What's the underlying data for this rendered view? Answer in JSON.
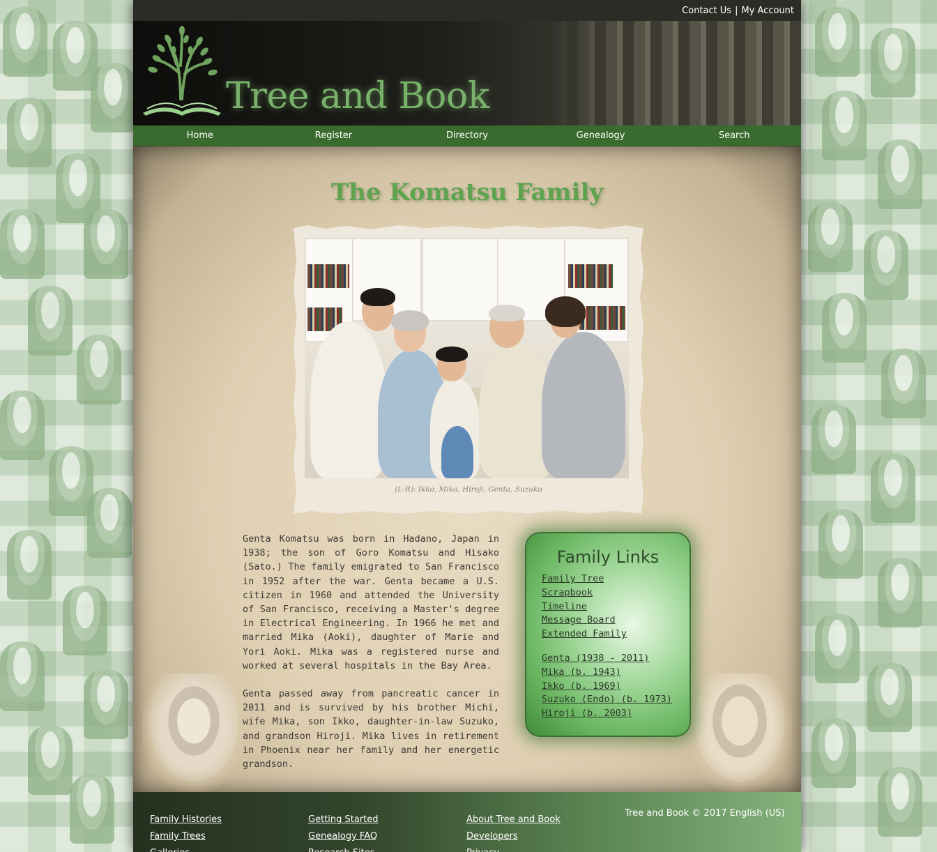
{
  "topbar": {
    "contact": "Contact Us",
    "separator": "|",
    "account": "My Account"
  },
  "site": {
    "title": "Tree and Book"
  },
  "nav": [
    {
      "label": "Home"
    },
    {
      "label": "Register"
    },
    {
      "label": "Directory"
    },
    {
      "label": "Genealogy"
    },
    {
      "label": "Search"
    }
  ],
  "main": {
    "title": "The Komatsu Family",
    "photo_caption": "(L-R): Ikko, Mika, Hiroji, Genta, Suzuko",
    "bio": [
      "Genta Komatsu was born in Hadano, Japan in 1938; the son of Goro Komatsu and Hisako (Sato.) The family emigrated to San Francisco in 1952 after the war. Genta became a U.S. citizen in 1960 and attended the University of San Francisco, receiving a Master's degree in Electrical Engineering. In 1966 he met and married Mika (Aoki), daughter of Marie and Yori Aoki. Mika was a registered nurse and worked at several hospitals in the Bay Area.",
      "Genta passed away from pancreatic cancer in 2011 and is survived by his brother Michi, wife Mika, son Ikko, daughter-in-law Suzuko, and grandson Hiroji. Mika lives in retirement in Phoenix near her family and her energetic grandson."
    ]
  },
  "family_links": {
    "title": "Family Links",
    "pages": [
      "Family Tree",
      "Scrapbook",
      "Timeline",
      "Message Board",
      "Extended Family"
    ],
    "members": [
      "Genta (1938 - 2011)",
      "Mika (b. 1943)",
      "Ikko (b. 1969)",
      "Suzuko (Endo) (b. 1973)",
      "Hiroji (b. 2003)"
    ]
  },
  "footer": {
    "col1": [
      "Family Histories",
      "Family Trees",
      "Galleries"
    ],
    "col2": [
      "Getting Started",
      "Genealogy FAQ",
      "Research Sites"
    ],
    "col3": [
      "About Tree and Book",
      "Developers",
      "Privacy"
    ],
    "copyright": "Tree and Book © 2017 English (US)"
  },
  "colors": {
    "nav_bg": "#3a6b2e",
    "title_green": "#5fa34f",
    "logo_green": "#79b26b",
    "parchment": "#dfcfb2"
  },
  "icons": {
    "logo": "tree-on-book-icon"
  }
}
